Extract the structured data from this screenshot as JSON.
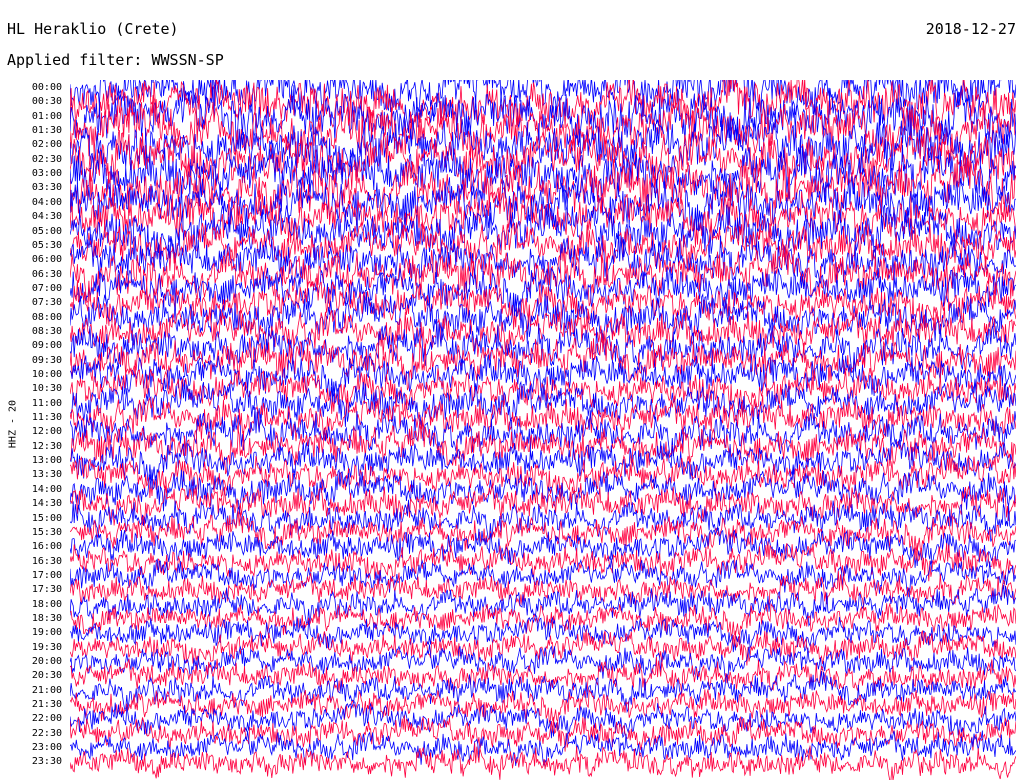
{
  "header": {
    "station": "HL Heraklio (Crete)",
    "date": "2018-12-27",
    "filter": "Applied filter: WWSSN-SP"
  },
  "chart_data": {
    "type": "line",
    "subtype": "helicorder",
    "title": "HL Heraklio (Crete)",
    "date": "2018-12-27",
    "filter": "WWSSN-SP",
    "ylabel": "HHZ - 20",
    "row_labels": [
      "00:00",
      "00:30",
      "01:00",
      "01:30",
      "02:00",
      "02:30",
      "03:00",
      "03:30",
      "04:00",
      "04:30",
      "05:00",
      "05:30",
      "06:00",
      "06:30",
      "07:00",
      "07:30",
      "08:00",
      "08:30",
      "09:00",
      "09:30",
      "10:00",
      "10:30",
      "11:00",
      "11:30",
      "12:00",
      "12:30",
      "13:00",
      "13:30",
      "14:00",
      "14:30",
      "15:00",
      "15:30",
      "16:00",
      "16:30",
      "17:00",
      "17:30",
      "18:00",
      "18:30",
      "19:00",
      "19:30",
      "20:00",
      "20:30",
      "21:00",
      "21:30",
      "22:00",
      "22:30",
      "23:00",
      "23:30"
    ],
    "row_minutes": 30,
    "series_colors": [
      "#0000ff",
      "#ff0040"
    ],
    "relative_amplitude": [
      1.6,
      1.7,
      1.8,
      1.8,
      1.8,
      1.8,
      1.8,
      1.8,
      1.7,
      1.6,
      1.6,
      1.5,
      1.5,
      1.5,
      1.4,
      1.4,
      1.4,
      1.4,
      1.4,
      1.4,
      1.3,
      1.3,
      1.3,
      1.3,
      1.3,
      1.3,
      1.2,
      1.2,
      1.2,
      1.2,
      1.1,
      1.1,
      1.1,
      1.1,
      1.0,
      1.0,
      1.0,
      1.0,
      1.0,
      1.0,
      1.0,
      1.0,
      1.0,
      1.0,
      1.0,
      1.0,
      1.0,
      1.0
    ],
    "grid": false
  }
}
